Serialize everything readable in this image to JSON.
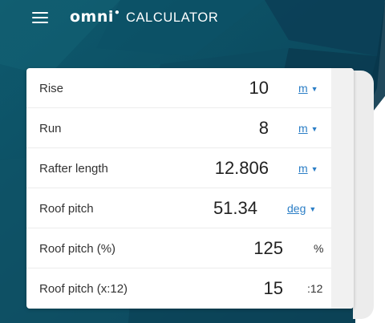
{
  "header": {
    "logo_word": "omni",
    "logo_product": "CALCULATOR"
  },
  "icons": {
    "menu": "hamburger-menu-icon",
    "dropdown": "triangle-down"
  },
  "colors": {
    "header_bg": "#0f4a5f",
    "link": "#2b7ec6",
    "card_bg": "#ffffff"
  },
  "rows": [
    {
      "label": "Rise",
      "value": "10",
      "unit": "m",
      "unit_type": "dropdown"
    },
    {
      "label": "Run",
      "value": "8",
      "unit": "m",
      "unit_type": "dropdown"
    },
    {
      "label": "Rafter length",
      "value": "12.806",
      "unit": "m",
      "unit_type": "dropdown"
    },
    {
      "label": "Roof pitch",
      "value": "51.34",
      "unit": "deg",
      "unit_type": "dropdown"
    },
    {
      "label": "Roof pitch (%)",
      "value": "125",
      "unit": "%",
      "unit_type": "static"
    },
    {
      "label": "Roof pitch (x:12)",
      "value": "15",
      "unit": ":12",
      "unit_type": "static"
    }
  ]
}
